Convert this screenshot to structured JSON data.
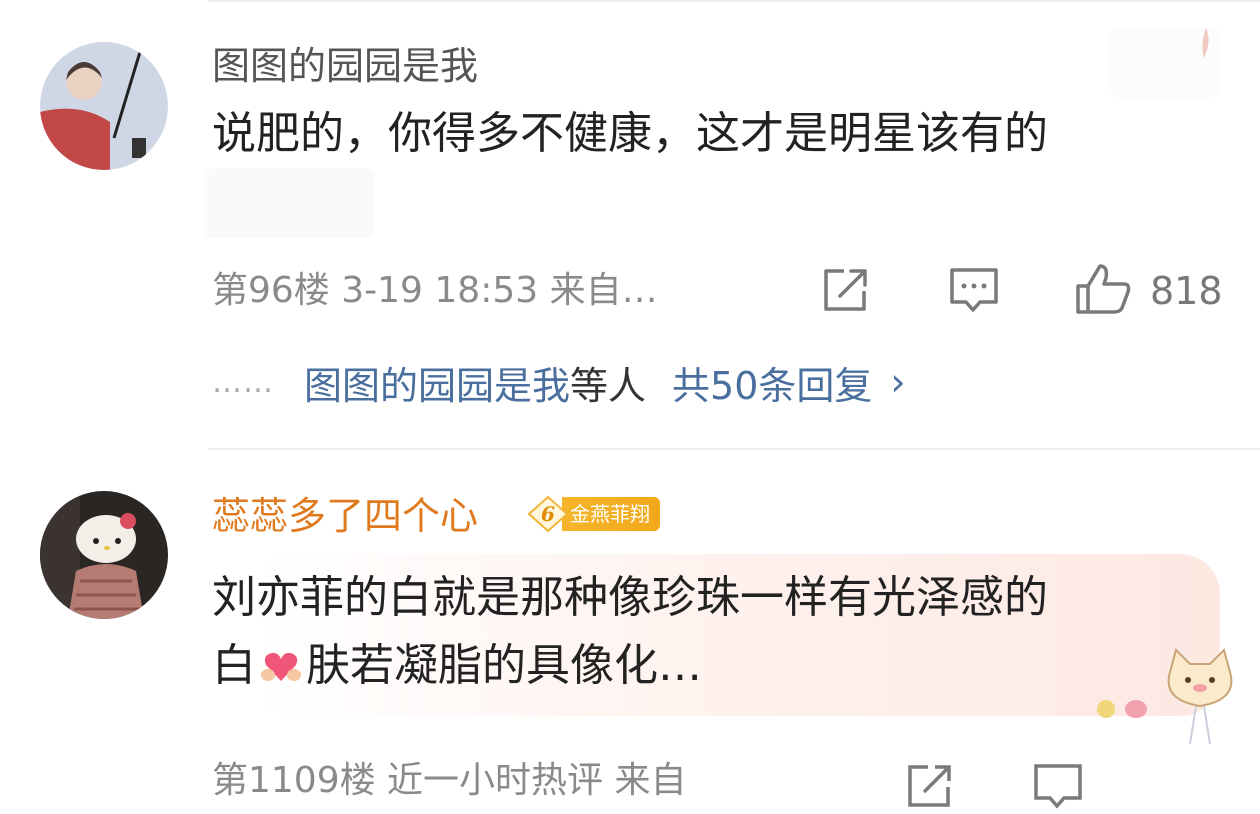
{
  "comments": [
    {
      "username": "图图的园园是我",
      "text": "说肥的，你得多不健康，这才是明星该有的",
      "meta": "第96楼 3-19 18:53 来自…",
      "likes": "818",
      "replies": {
        "dots": "……",
        "user": "图图的园园是我",
        "and": "等人",
        "count": "共50条回复",
        "chevron": "›"
      }
    },
    {
      "username": "蕊蕊多了四个心",
      "badge": {
        "level": "6",
        "label": "金燕菲翔"
      },
      "text_line1": "刘亦菲的白就是那种像珍珠一样有光泽感的",
      "text_line2_pre": "白",
      "text_line2_post": "肤若凝脂的具像化…"
    }
  ],
  "next_meta_partial": "第1109楼 近一小时热评 来自",
  "icons": {
    "share": "share-square-icon",
    "reply": "comment-bubble-icon",
    "like": "thumbs-up-icon",
    "heart": "heart-hands-emoji-icon"
  },
  "colors": {
    "reply_link": "#4a6f9e",
    "vip_username": "#e07a1f",
    "badge": "#f2a81a"
  }
}
